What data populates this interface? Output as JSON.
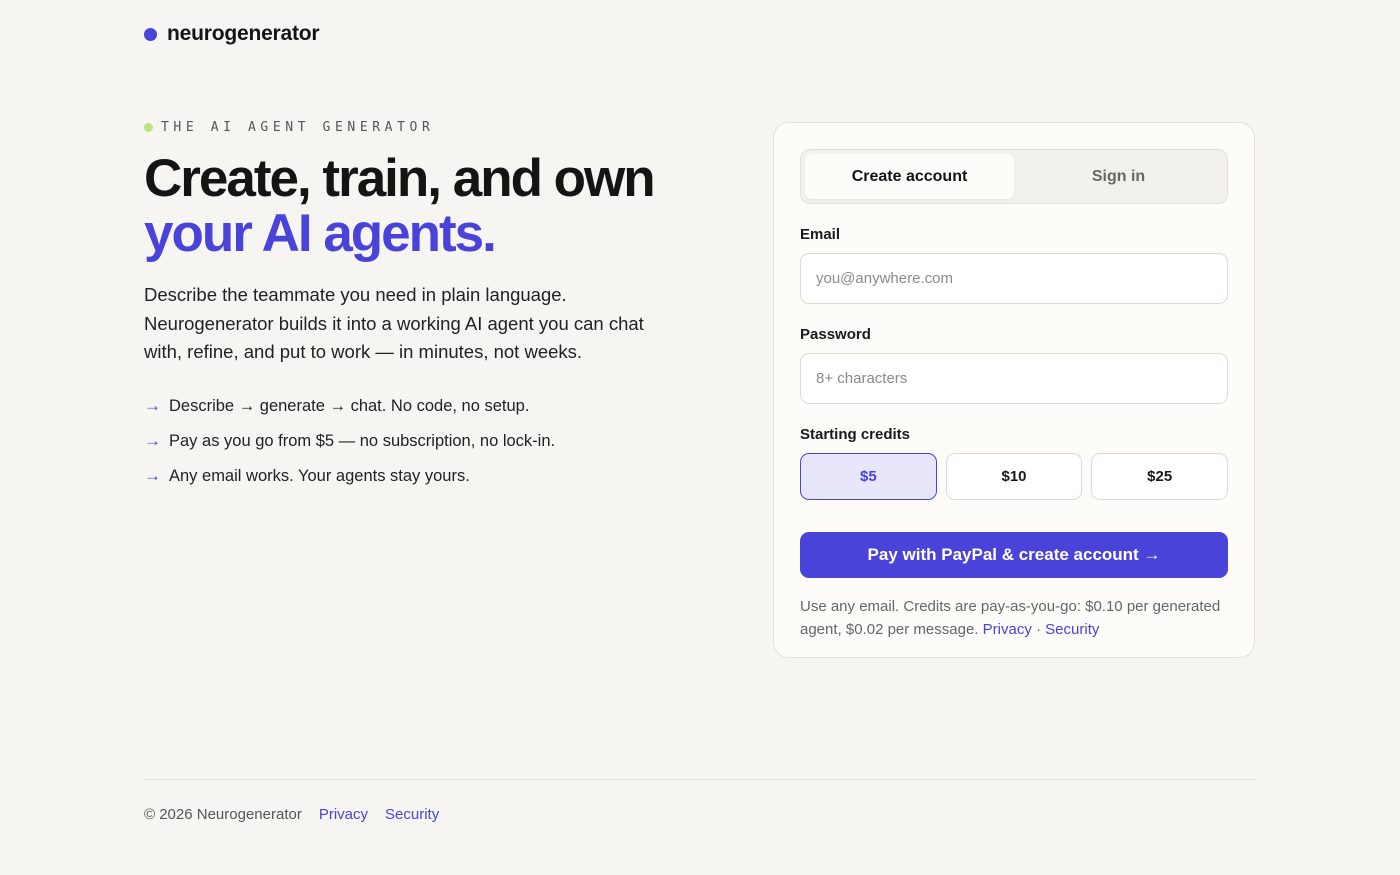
{
  "brand": {
    "name": "neurogenerator"
  },
  "hero": {
    "eyebrow": "THE AI AGENT GENERATOR",
    "headline_line1": "Create, train, and own",
    "headline_line2": "your AI agents.",
    "lede": "Describe the teammate you need in plain language. Neurogenerator builds it into a working AI agent you can chat with, refine, and put to work — in minutes, not weeks.",
    "features": [
      "Describe → generate → chat. No code, no setup.",
      "Pay as you go from $5 — no subscription, no lock-in.",
      "Any email works. Your agents stay yours."
    ]
  },
  "auth": {
    "tabs": [
      "Create account",
      "Sign in"
    ],
    "active_tab": "Create account",
    "email": {
      "label": "Email",
      "value": "",
      "placeholder": "you@anywhere.com"
    },
    "password": {
      "label": "Password",
      "value": "",
      "placeholder": "8+ characters"
    },
    "credits": {
      "label": "Starting credits",
      "options": [
        "$5",
        "$10",
        "$25"
      ],
      "selected": "$5"
    },
    "submit_label": "Pay with PayPal & create account →",
    "note_text": "Use any email. Credits are pay-as-you-go: $0.10 per generated agent, $0.02 per message.",
    "note_privacy": "Privacy",
    "note_separator": "·",
    "note_security": "Security"
  },
  "footer": {
    "copyright": "© 2026 Neurogenerator",
    "privacy": "Privacy",
    "security": "Security"
  },
  "colors": {
    "accent": "#4a43d9",
    "eyebrow_dot": "#b9e67c",
    "background": "#f6f5f1"
  },
  "icons": {
    "feature_bullet": "arrow-right-icon"
  }
}
